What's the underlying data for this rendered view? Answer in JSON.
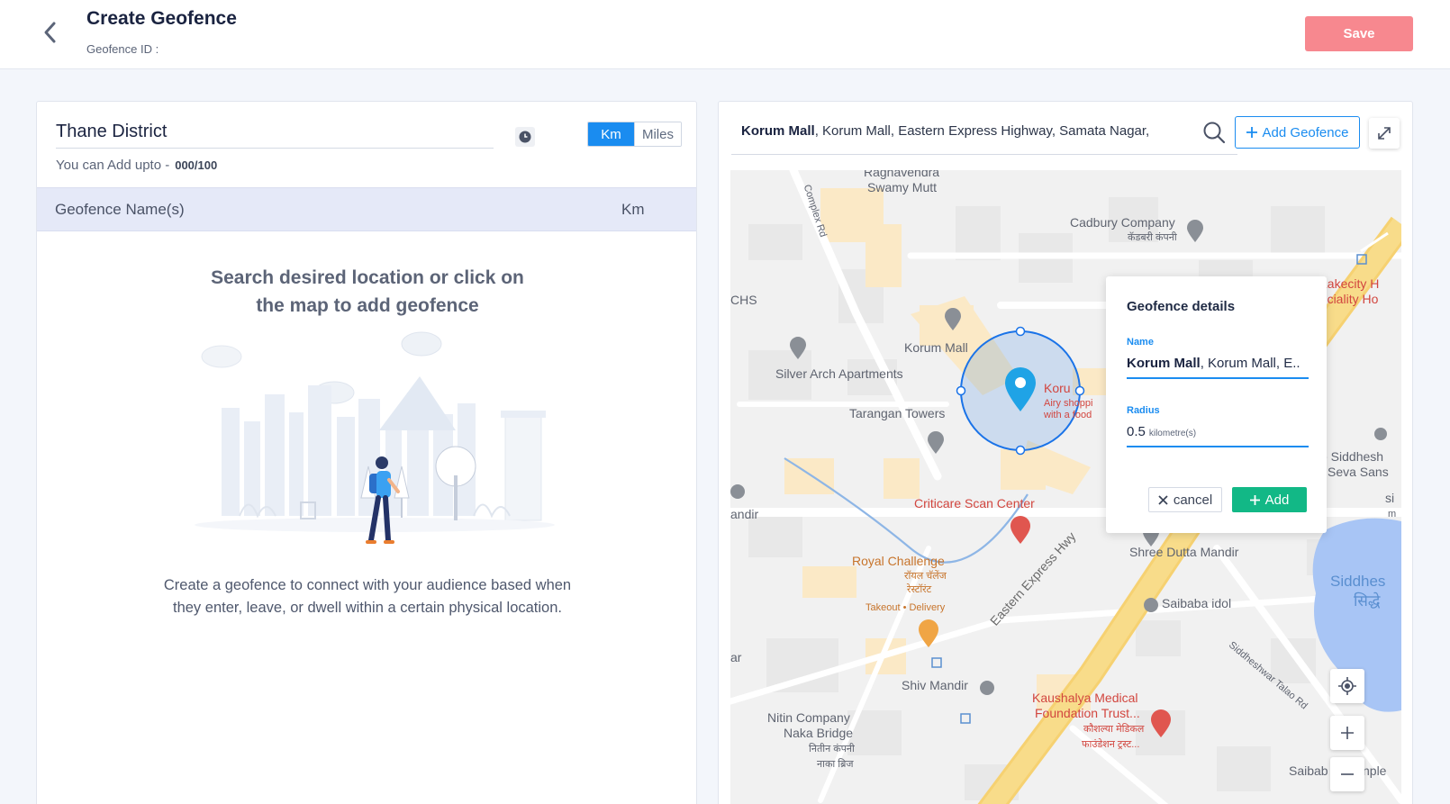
{
  "header": {
    "title": "Create Geofence",
    "subtitle": "Geofence ID :",
    "save_label": "Save"
  },
  "left": {
    "region_value": "Thane District",
    "units": {
      "km": "Km",
      "miles": "Miles",
      "selected": "Km"
    },
    "add_limit_label": "You can Add upto -",
    "add_limit_count": "000/100",
    "table_header_name": "Geofence Name(s)",
    "table_header_unit": "Km",
    "empty_title_line1": "Search desired location or click on",
    "empty_title_line2": "the map to add geofence",
    "empty_desc_line1": "Create a geofence to connect with your audience based when",
    "empty_desc_line2": "they enter, leave, or dwell within a certain physical location."
  },
  "right": {
    "search_bold": "Korum Mall",
    "search_rest": ", Korum Mall, Eastern Express Highway, Samata Nagar,",
    "add_geofence_label": "Add Geofence"
  },
  "map": {
    "labels": {
      "raghavendra": "Raghavendra",
      "swamy_mutt": "Swamy Mutt",
      "complex_rd": "Complex Rd",
      "cadbury": "Cadbury Company",
      "cadbury_hi": "कॅडबरी कंपनी",
      "chs": "CHS",
      "korum_mall": "Korum Mall",
      "silver_arch": "Silver Arch Apartments",
      "tarangan": "Tarangan Towers",
      "koru": "Koru",
      "airy": "Airy shoppi",
      "with_food": "with a food",
      "lakecity1": "Lakecity H",
      "lakecity2": "peciality Ho",
      "siddhesh1": "e Siddhesh",
      "siddhesh2": "Seva Sans",
      "criticare": "Criticare Scan Center",
      "andir": "andir",
      "royal": "Royal Challenge",
      "royal_hi1": "रॉयल चॅलेंज",
      "royal_hi2": "रेस्टॉरंट",
      "takeout": "Takeout • Delivery",
      "eastern_hwy": "Eastern Express Hwy",
      "shree_dutta": "Shree Dutta Mandir",
      "saibaba_idol": "Saibaba idol",
      "siddhes_lake": "Siddhes",
      "siddhes_lake_hi": "सिद्धे",
      "siddheshwar_rd": "Siddheshwar Talao Rd",
      "ar": "ar",
      "shiv_mandir": "Shiv Mandir",
      "kaushalya1": "Kaushalya Medical",
      "kaushalya2": "Foundation Trust...",
      "kaushalya_hi1": "कौशल्या मेडिकल",
      "kaushalya_hi2": "फाउंडेशन ट्रस्ट...",
      "nitin1": "Nitin Company",
      "nitin2": "Naka Bridge",
      "nitin_hi1": "नितीन कंपनी",
      "nitin_hi2": "नाका ब्रिज",
      "saibab": "Saibab",
      "nple": "nple",
      "si": "si",
      "m": "m"
    }
  },
  "details": {
    "title": "Geofence details",
    "name_label": "Name",
    "name_bold": "Korum Mall",
    "name_rest": ", Korum Mall, E..",
    "radius_label": "Radius",
    "radius_value": "0.5",
    "radius_unit": "kilometre(s)",
    "cancel_label": "cancel",
    "add_label": "Add"
  },
  "colors": {
    "accent": "#1a8cf0",
    "save": "#f7888f",
    "add_green": "#12b886",
    "table_header_bg": "#e5e9f8"
  }
}
